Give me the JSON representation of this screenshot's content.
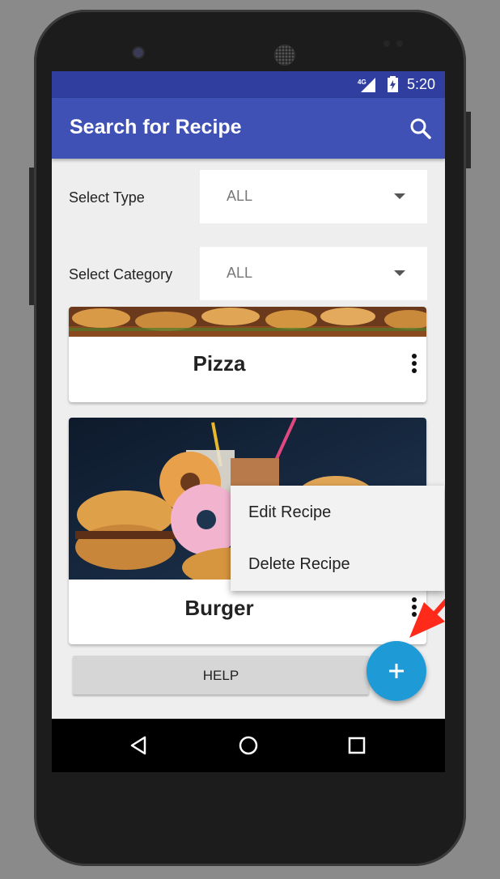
{
  "status_bar": {
    "time": "5:20",
    "network": "4G"
  },
  "app_bar": {
    "title": "Search for Recipe",
    "search_icon": "search-icon"
  },
  "filters": {
    "type": {
      "label": "Select Type",
      "value": "ALL"
    },
    "category": {
      "label": "Select Category",
      "value": "ALL"
    }
  },
  "cards": [
    {
      "title": "Pizza"
    },
    {
      "title": "Burger"
    }
  ],
  "popup_menu": {
    "items": [
      "Edit Recipe",
      "Delete Recipe"
    ]
  },
  "help_button": {
    "label": "HELP"
  },
  "fab": {
    "label": "+"
  },
  "colors": {
    "status_bar": "#303f9f",
    "app_bar": "#3f51b5",
    "fab": "#1e9bd7",
    "annotation_arrow": "#ff2a1a"
  }
}
